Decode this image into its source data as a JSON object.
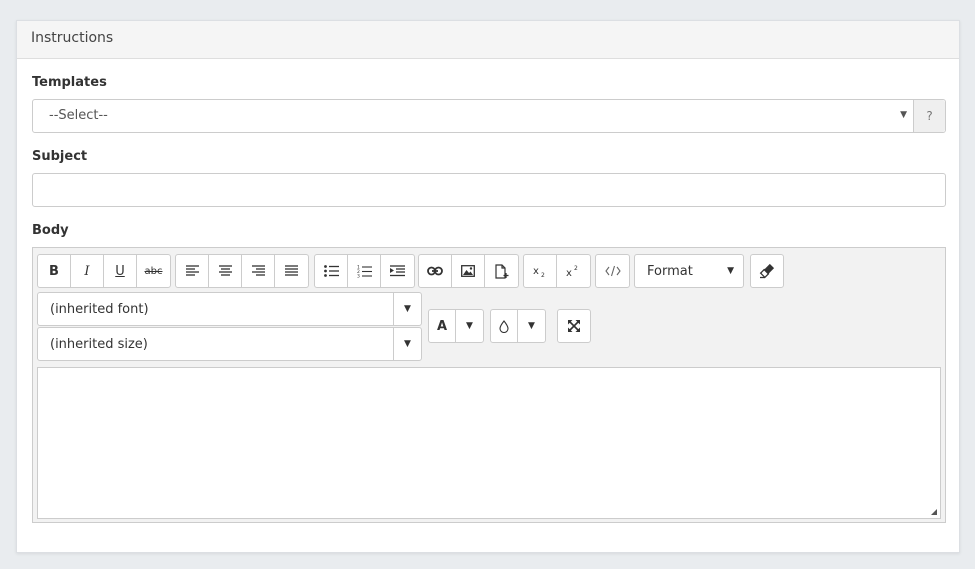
{
  "panel": {
    "title": "Instructions"
  },
  "templates": {
    "label": "Templates",
    "selected": "--Select--",
    "help": "?"
  },
  "subject": {
    "label": "Subject",
    "value": ""
  },
  "body": {
    "label": "Body",
    "toolbar": {
      "bold": "B",
      "italic": "I",
      "underline": "U",
      "strike": "abc",
      "format_label": "Format",
      "font_color_label": "A"
    },
    "font": "(inherited font)",
    "size": "(inherited size)"
  },
  "icons": {
    "select_caret": "caret-down-icon",
    "align_left": "align-left-icon",
    "align_center": "align-center-icon",
    "align_right": "align-right-icon",
    "align_justify": "align-justify-icon",
    "bullet_list": "bullet-list-icon",
    "numbered_list": "numbered-list-icon",
    "indent": "indent-icon",
    "link": "link-icon",
    "image": "image-icon",
    "file": "file-add-icon",
    "subscript": "subscript-icon",
    "superscript": "superscript-icon",
    "code": "code-icon",
    "eraser": "eraser-icon",
    "drop": "drop-icon",
    "expand": "expand-icon"
  }
}
